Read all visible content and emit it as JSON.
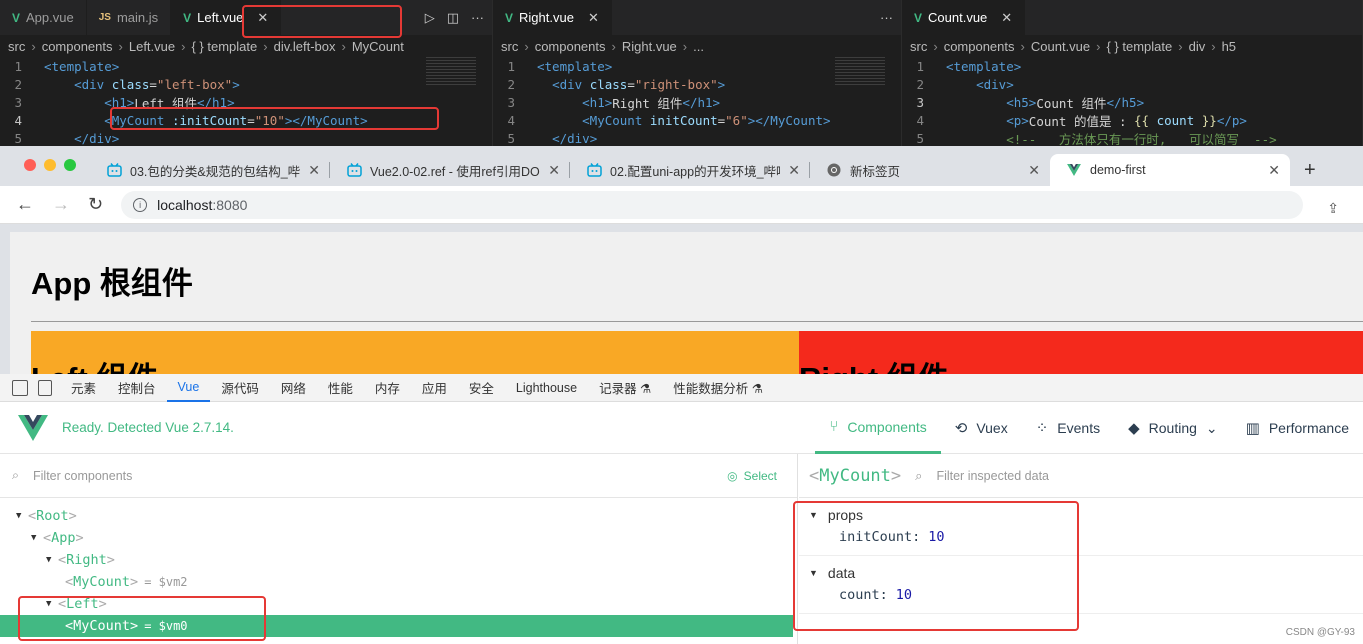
{
  "editor": {
    "pane1": {
      "tabs": [
        {
          "label": "App.vue",
          "type": "vue"
        },
        {
          "label": "main.js",
          "type": "js"
        },
        {
          "label": "Left.vue",
          "type": "vue",
          "active": true
        }
      ],
      "crumbs": [
        "src",
        "components",
        "Left.vue",
        "{ } template",
        "div.left-box",
        "MyCount"
      ],
      "lines": [
        {
          "n": "1",
          "code": [
            [
              "tg",
              "<template>"
            ]
          ]
        },
        {
          "n": "2",
          "code": [
            [
              "tx",
              "    "
            ],
            [
              "tg",
              "<div "
            ],
            [
              "at",
              "class"
            ],
            [
              "tx",
              "="
            ],
            [
              "st",
              "\"left-box\""
            ],
            [
              "tg",
              ">"
            ]
          ]
        },
        {
          "n": "3",
          "code": [
            [
              "tx",
              "        "
            ],
            [
              "tg",
              "<h1>"
            ],
            [
              "tx",
              "Left 组件"
            ],
            [
              "tg",
              "</h1>"
            ]
          ]
        },
        {
          "n": "4",
          "code": [
            [
              "tx",
              "        "
            ],
            [
              "tg",
              "<MyCount "
            ],
            [
              "at",
              ":initCount"
            ],
            [
              "tx",
              "="
            ],
            [
              "st",
              "\"10\""
            ],
            [
              "tg",
              "></MyCount>"
            ]
          ],
          "current": true
        },
        {
          "n": "5",
          "code": [
            [
              "tx",
              "    "
            ],
            [
              "tg",
              "</div>"
            ]
          ]
        }
      ]
    },
    "pane2": {
      "tabs": [
        {
          "label": "Right.vue",
          "type": "vue",
          "active": true
        }
      ],
      "crumbs": [
        "src",
        "components",
        "Right.vue",
        "..."
      ],
      "lines": [
        {
          "n": "1",
          "code": [
            [
              "tg",
              "<template>"
            ]
          ]
        },
        {
          "n": "2",
          "code": [
            [
              "tx",
              "  "
            ],
            [
              "tg",
              "<div "
            ],
            [
              "at",
              "class"
            ],
            [
              "tx",
              "="
            ],
            [
              "st",
              "\"right-box\""
            ],
            [
              "tg",
              ">"
            ]
          ]
        },
        {
          "n": "3",
          "code": [
            [
              "tx",
              "      "
            ],
            [
              "tg",
              "<h1>"
            ],
            [
              "tx",
              "Right 组件"
            ],
            [
              "tg",
              "</h1>"
            ]
          ]
        },
        {
          "n": "4",
          "code": [
            [
              "tx",
              "      "
            ],
            [
              "tg",
              "<MyCount "
            ],
            [
              "at",
              "initCount"
            ],
            [
              "tx",
              "="
            ],
            [
              "st",
              "\"6\""
            ],
            [
              "tg",
              "></MyCount>"
            ]
          ]
        },
        {
          "n": "5",
          "code": [
            [
              "tx",
              "  "
            ],
            [
              "tg",
              "</div>"
            ]
          ]
        }
      ]
    },
    "pane3": {
      "tabs": [
        {
          "label": "Count.vue",
          "type": "vue",
          "active": true
        }
      ],
      "crumbs": [
        "src",
        "components",
        "Count.vue",
        "{ } template",
        "div",
        "h5"
      ],
      "lines": [
        {
          "n": "1",
          "code": [
            [
              "tg",
              "<template>"
            ]
          ]
        },
        {
          "n": "2",
          "code": [
            [
              "tx",
              "    "
            ],
            [
              "tg",
              "<div>"
            ]
          ]
        },
        {
          "n": "3",
          "code": [
            [
              "tx",
              "        "
            ],
            [
              "tg",
              "<h5>"
            ],
            [
              "tx",
              "Count 组件"
            ],
            [
              "tg",
              "</h5>"
            ]
          ],
          "current": true
        },
        {
          "n": "4",
          "code": [
            [
              "tx",
              "        "
            ],
            [
              "tg",
              "<p>"
            ],
            [
              "tx",
              "Count 的值是 : "
            ],
            [
              "br",
              "{{ "
            ],
            [
              "vr",
              "count"
            ],
            [
              "br",
              " }}"
            ],
            [
              "tg",
              "</p>"
            ]
          ]
        },
        {
          "n": "5",
          "code": [
            [
              "tx",
              "        "
            ],
            [
              "cm",
              "<!--   方法体只有一行时,   可以简写  -->"
            ]
          ]
        }
      ]
    },
    "more_label": "···"
  },
  "browser": {
    "tabs": [
      {
        "title": "03.包的分类&规范的包结构_哔哩",
        "icon": "bili"
      },
      {
        "title": "Vue2.0-02.ref - 使用ref引用DO",
        "icon": "bili"
      },
      {
        "title": "02.配置uni-app的开发环境_哔哩",
        "icon": "bili"
      },
      {
        "title": "新标签页",
        "icon": "chrome"
      },
      {
        "title": "demo-first",
        "icon": "vue",
        "active": true
      }
    ],
    "url_host": "localhost",
    "url_port": ":8080",
    "page": {
      "app_title": "App 根组件",
      "left_title": "Left 组件",
      "right_title": "Right 组件"
    }
  },
  "devtools": {
    "tabs": [
      "元素",
      "控制台",
      "Vue",
      "源代码",
      "网络",
      "性能",
      "内存",
      "应用",
      "安全",
      "Lighthouse",
      "记录器 ⚗",
      "性能数据分析 ⚗"
    ],
    "active_tab": "Vue",
    "ready_text": "Ready. Detected Vue 2.7.14.",
    "nav": [
      {
        "label": "Components",
        "icon": "components-icon",
        "glyph": "⑂",
        "active": true
      },
      {
        "label": "Vuex",
        "icon": "history-icon",
        "glyph": "⟲"
      },
      {
        "label": "Events",
        "icon": "events-icon",
        "glyph": "⁘"
      },
      {
        "label": "Routing",
        "icon": "routing-icon",
        "glyph": "◆",
        "dropdown": "⌄"
      },
      {
        "label": "Performance",
        "icon": "chart-icon",
        "glyph": "▥"
      }
    ],
    "filter_placeholder": "Filter components",
    "select_label": "Select",
    "tree": [
      {
        "name": "Root",
        "depth": 0,
        "open": true
      },
      {
        "name": "App",
        "depth": 1,
        "open": true
      },
      {
        "name": "Right",
        "depth": 2,
        "open": true
      },
      {
        "name": "MyCount",
        "depth": 3,
        "ref": "= $vm2"
      },
      {
        "name": "Left",
        "depth": 2,
        "open": true
      },
      {
        "name": "MyCount",
        "depth": 3,
        "ref": "= $vm0",
        "selected": true
      }
    ],
    "inspector": {
      "component": "MyCount",
      "filter_placeholder": "Filter inspected data",
      "sections": [
        {
          "title": "props",
          "items": [
            {
              "key": "initCount:",
              "value": "10"
            }
          ]
        },
        {
          "title": "data",
          "items": [
            {
              "key": "count:",
              "value": "10"
            }
          ]
        }
      ]
    },
    "watermark": "CSDN @GY-93"
  },
  "colors": {
    "vue_green": "#42b983",
    "highlight_red": "#e53935",
    "left_box": "#f9a825",
    "right_box": "#f4291c"
  }
}
